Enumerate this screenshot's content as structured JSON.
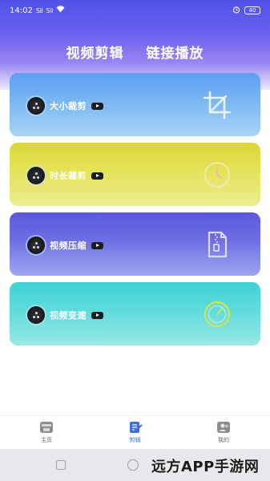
{
  "status_bar": {
    "time": "14:02",
    "signal_1": "Sil",
    "signal_2": "Sil",
    "wifi_icon": "wifi-icon",
    "battery": "40"
  },
  "top_tabs": [
    "视频剪辑",
    "链接播放"
  ],
  "cards": [
    {
      "title": "大小裁剪",
      "icon": "crop-icon",
      "gradient": [
        "#5b9df0",
        "#a9d4f5"
      ]
    },
    {
      "title": "时长裁剪",
      "icon": "clock-icon",
      "gradient": [
        "#d8d836",
        "#ecec90"
      ]
    },
    {
      "title": "视频压缩",
      "icon": "zip-file-icon",
      "gradient": [
        "#5a58dc",
        "#9ea8ee"
      ]
    },
    {
      "title": "视频变速",
      "icon": "speedometer-icon",
      "gradient": [
        "#3fd2d6",
        "#9ae8e6"
      ]
    }
  ],
  "bottom_nav": {
    "items": [
      {
        "label": "主页",
        "icon": "home-store-icon",
        "active": false
      },
      {
        "label": "剪辑",
        "icon": "edit-doc-icon",
        "active": true
      },
      {
        "label": "我的",
        "icon": "user-icon",
        "active": false
      }
    ],
    "accent": "#3b6fe0"
  },
  "watermark": "远方APP手游网"
}
